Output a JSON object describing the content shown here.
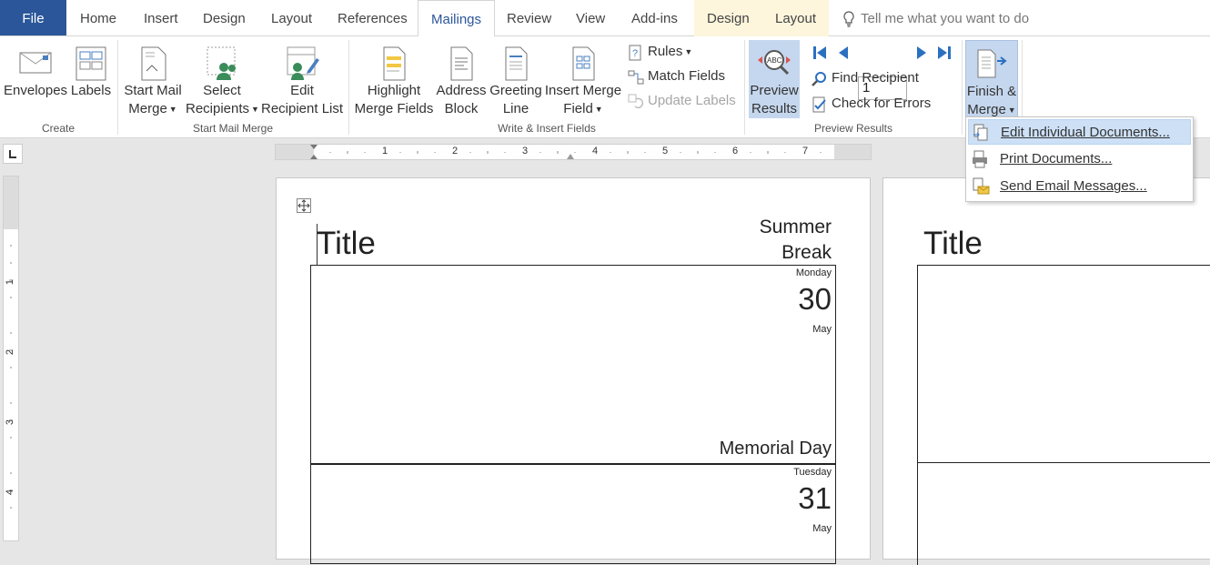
{
  "tabs": {
    "file": "File",
    "home": "Home",
    "insert": "Insert",
    "design": "Design",
    "layout": "Layout",
    "references": "References",
    "mailings": "Mailings",
    "review": "Review",
    "view": "View",
    "addins": "Add-ins",
    "ctx_design": "Design",
    "ctx_layout": "Layout",
    "tellme": "Tell me what you want to do"
  },
  "ribbon": {
    "create": {
      "label": "Create",
      "envelopes": "Envelopes",
      "labels": "Labels"
    },
    "start": {
      "label": "Start Mail Merge",
      "start_l1": "Start Mail",
      "start_l2": "Merge",
      "select_l1": "Select",
      "select_l2": "Recipients",
      "edit_l1": "Edit",
      "edit_l2": "Recipient List"
    },
    "write": {
      "label": "Write & Insert Fields",
      "highlight_l1": "Highlight",
      "highlight_l2": "Merge Fields",
      "address_l1": "Address",
      "address_l2": "Block",
      "greeting_l1": "Greeting",
      "greeting_l2": "Line",
      "insert_l1": "Insert Merge",
      "insert_l2": "Field",
      "rules": "Rules",
      "match": "Match Fields",
      "update": "Update Labels"
    },
    "preview": {
      "label": "Preview Results",
      "preview_l1": "Preview",
      "preview_l2": "Results",
      "record": "1",
      "find": "Find Recipient",
      "check": "Check for Errors"
    },
    "finish": {
      "l1": "Finish &",
      "l2": "Merge"
    }
  },
  "menu": {
    "edit": "Edit Individual Documents...",
    "print": "Print Documents...",
    "email": "Send Email Messages..."
  },
  "ruler": {
    "h": [
      "1",
      "2",
      "3",
      "4",
      "5",
      "6",
      "7"
    ],
    "v": [
      "1",
      "2",
      "3",
      "4"
    ]
  },
  "page1": {
    "title": "Title",
    "sub1": "Summer",
    "sub2": "Break",
    "day1": {
      "name": "Monday",
      "num": "30",
      "month": "May",
      "holiday": "Memorial Day"
    },
    "day2": {
      "name": "Tuesday",
      "num": "31",
      "month": "May"
    }
  },
  "page2": {
    "title": "Title"
  }
}
